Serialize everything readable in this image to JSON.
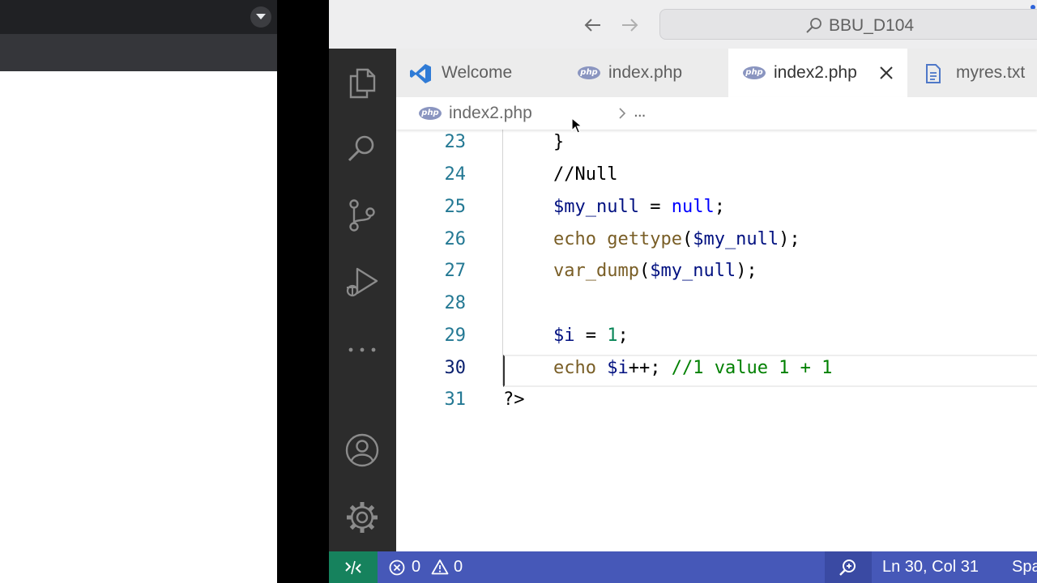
{
  "vscode": {
    "command_center": {
      "label": "BBU_D104"
    },
    "tabs": [
      {
        "label": "Welcome",
        "icon": "vscode-logo-icon"
      },
      {
        "label": "index.php",
        "icon": "php-icon",
        "badge": "php"
      },
      {
        "label": "index2.php",
        "icon": "php-icon",
        "badge": "php",
        "active": true
      },
      {
        "label": "myres.txt",
        "icon": "file-text-icon"
      }
    ],
    "breadcrumb": {
      "badge": "php",
      "file": "index2.php",
      "more": "..."
    },
    "editor": {
      "current_line": 30,
      "lines": [
        {
          "num": "23",
          "code": "}"
        },
        {
          "num": "24",
          "code": "//Null"
        },
        {
          "num": "25",
          "code": "$my_null = null;"
        },
        {
          "num": "26",
          "code": "echo gettype($my_null);"
        },
        {
          "num": "27",
          "code": "var_dump($my_null);"
        },
        {
          "num": "28",
          "code": ""
        },
        {
          "num": "29",
          "code": "$i = 1;"
        },
        {
          "num": "30",
          "code": "echo $i++; //1 value 1 + 1"
        },
        {
          "num": "31",
          "code": "?>"
        }
      ]
    },
    "statusbar": {
      "errors": "0",
      "warnings": "0",
      "cursor_position": "Ln 30, Col 31",
      "spaces": "Spa"
    },
    "colors": {
      "activity_bar": "#2c2c2c",
      "status_bar": "#4658b8",
      "remote_indicator": "#16825d",
      "comment": "#008000",
      "variable": "#001080",
      "keyword": "#0000ff",
      "function": "#795e26",
      "number": "#098658",
      "php_tag": "#800000",
      "line_number": "#237893"
    }
  }
}
